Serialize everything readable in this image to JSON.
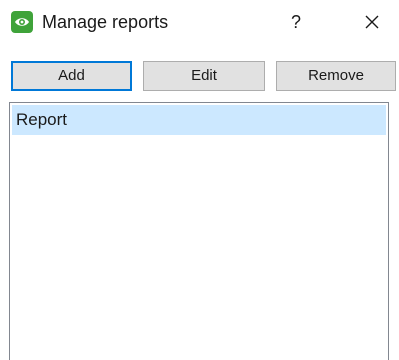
{
  "window": {
    "title": "Manage reports",
    "help_label": "?",
    "icons": {
      "app": "eye-icon",
      "close": "close-icon"
    }
  },
  "toolbar": {
    "add_label": "Add",
    "edit_label": "Edit",
    "remove_label": "Remove"
  },
  "reports": {
    "items": [
      {
        "label": "Report",
        "selected": true
      }
    ]
  },
  "colors": {
    "app_icon": "#3fa33a",
    "focus_border": "#0078d7",
    "selection": "#cce8ff",
    "button_bg": "#e1e1e1"
  }
}
